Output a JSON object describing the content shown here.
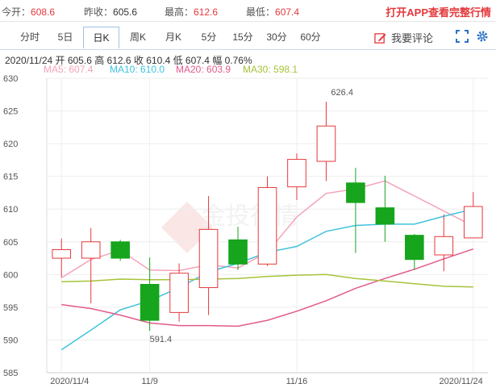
{
  "topbar": {
    "open_label": "今开：",
    "open_value": "608.6",
    "prevclose_label": "昨收：",
    "prevclose_value": "605.6",
    "high_label": "最高：",
    "high_value": "612.6",
    "low_label": "最低：",
    "low_value": "607.4",
    "app_link": "打开APP查看完整行情"
  },
  "tabs": [
    "分时",
    "5日",
    "日K",
    "周K",
    "月K",
    "5分",
    "15分",
    "30分",
    "60分"
  ],
  "active_tab": "日K",
  "comment_label": "我要评论",
  "info_line": "2020/11/24  开 605.6  高 612.6  收 610.4  低 607.4  幅 0.76%",
  "ma": [
    {
      "text": "MA5: 607.4",
      "color": "#f5a3b8"
    },
    {
      "text": "MA10: 610.0",
      "color": "#3ec3de"
    },
    {
      "text": "MA20: 603.9",
      "color": "#e35a8c"
    },
    {
      "text": "MA30: 598.1",
      "color": "#a6c33a"
    }
  ],
  "colors": {
    "up": "#e4393c",
    "down": "#16a51c",
    "bg": "#ffffff"
  },
  "chart_data": {
    "type": "candlestick",
    "ylim": [
      585,
      630
    ],
    "y_ticks": [
      585,
      590,
      595,
      600,
      605,
      610,
      615,
      620,
      625,
      630
    ],
    "x_tick_labels": [
      {
        "index": 0,
        "label": "2020/11/4"
      },
      {
        "index": 3,
        "label": "11/9"
      },
      {
        "index": 8,
        "label": "11/16"
      },
      {
        "index": 14,
        "label": "2020/11/24"
      }
    ],
    "annotations": [
      {
        "index": 9,
        "value": 626.4,
        "label": "626.4",
        "at": "high"
      },
      {
        "index": 3,
        "value": 591.4,
        "label": "591.4",
        "at": "low"
      }
    ],
    "candles": [
      {
        "open": 602.5,
        "close": 603.8,
        "high": 605.5,
        "low": 599.6
      },
      {
        "open": 602.5,
        "close": 605.0,
        "high": 607.1,
        "low": 595.6
      },
      {
        "open": 605.0,
        "close": 602.5,
        "high": 605.3,
        "low": 602.1
      },
      {
        "open": 598.5,
        "close": 593.0,
        "high": 602.6,
        "low": 591.4
      },
      {
        "open": 594.2,
        "close": 600.2,
        "high": 601.7,
        "low": 592.8
      },
      {
        "open": 598.0,
        "close": 606.9,
        "high": 612.0,
        "low": 593.8
      },
      {
        "open": 605.3,
        "close": 601.6,
        "high": 607.3,
        "low": 600.7
      },
      {
        "open": 601.6,
        "close": 613.3,
        "high": 615.0,
        "low": 601.3
      },
      {
        "open": 613.4,
        "close": 617.6,
        "high": 618.5,
        "low": 611.4
      },
      {
        "open": 617.3,
        "close": 622.7,
        "high": 626.4,
        "low": 614.3
      },
      {
        "open": 614.0,
        "close": 611.0,
        "high": 616.3,
        "low": 603.3
      },
      {
        "open": 610.2,
        "close": 607.7,
        "high": 615.1,
        "low": 605.0
      },
      {
        "open": 606.0,
        "close": 602.3,
        "high": 606.2,
        "low": 600.7
      },
      {
        "open": 603.0,
        "close": 605.8,
        "high": 609.2,
        "low": 600.5
      },
      {
        "open": 605.6,
        "close": 610.4,
        "high": 612.6,
        "low": 607.4
      }
    ],
    "ma_series": [
      {
        "name": "MA5",
        "color": "#f5a3b8",
        "values": [
          599.5,
          602.3,
          603.7,
          600.7,
          600.6,
          601.5,
          601.0,
          603.4,
          608.8,
          612.4,
          613.1,
          614.3,
          null,
          null,
          607.4
        ]
      },
      {
        "name": "MA10",
        "color": "#3ec3de",
        "values": [
          588.5,
          591.5,
          594.6,
          596.0,
          598.0,
          600.4,
          601.7,
          603.4,
          604.3,
          606.6,
          607.5,
          607.7,
          607.7,
          608.9,
          610.0
        ]
      },
      {
        "name": "MA20",
        "color": "#e35a8c",
        "values": [
          595.4,
          594.8,
          593.8,
          592.6,
          592.2,
          592.2,
          592.1,
          593.0,
          594.4,
          596.0,
          597.9,
          599.4,
          600.8,
          602.4,
          603.9
        ]
      },
      {
        "name": "MA30",
        "color": "#a6c33a",
        "values": [
          598.9,
          599.0,
          599.3,
          599.2,
          599.2,
          599.3,
          599.4,
          599.7,
          599.9,
          600.0,
          599.4,
          599.0,
          598.6,
          598.2,
          598.1
        ]
      }
    ]
  }
}
